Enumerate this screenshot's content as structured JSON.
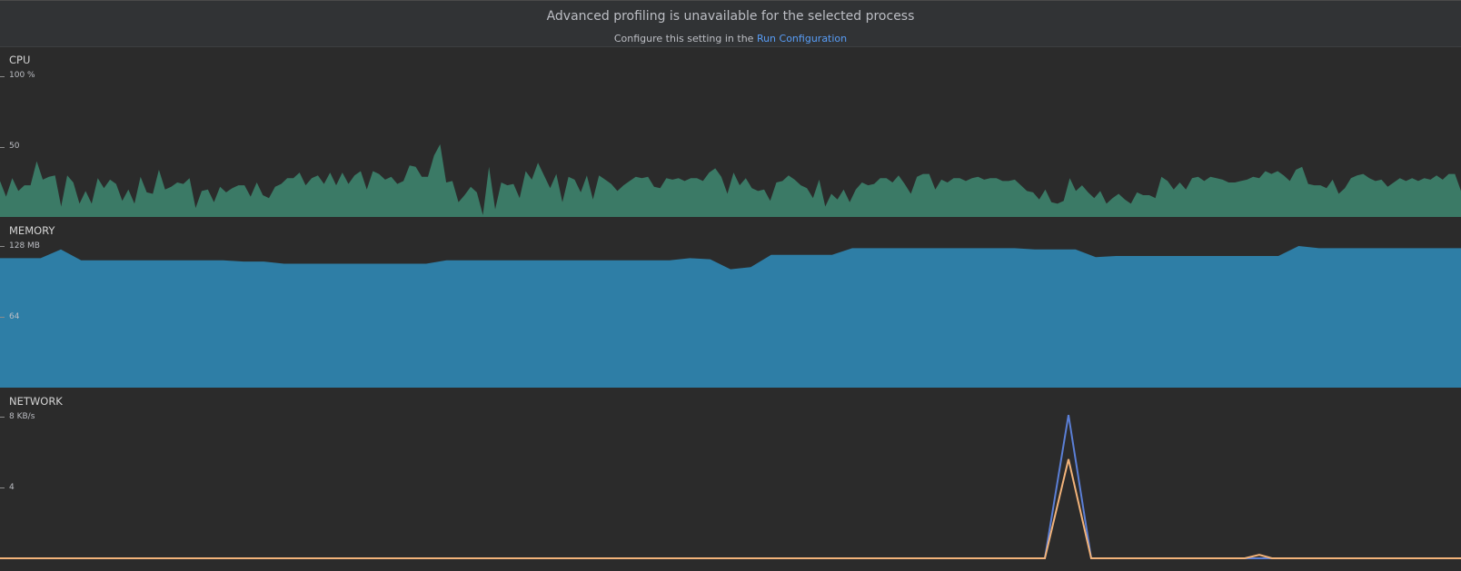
{
  "banner": {
    "title": "Advanced profiling is unavailable for the selected process",
    "subtitle_prefix": "Configure this setting in the",
    "link_label": "Run Configuration"
  },
  "cpu": {
    "title": "CPU",
    "ticks": [
      "100 %",
      "50"
    ],
    "color": "#3b7a66",
    "values": [
      26,
      15,
      28,
      19,
      23,
      23,
      40,
      27,
      29,
      30,
      8,
      30,
      25,
      10,
      19,
      10,
      28,
      21,
      27,
      24,
      12,
      20,
      10,
      29,
      18,
      17,
      34,
      20,
      22,
      25,
      24,
      28,
      7,
      19,
      20,
      11,
      22,
      18,
      21,
      23,
      23,
      15,
      25,
      16,
      14,
      22,
      24,
      28,
      28,
      32,
      23,
      28,
      30,
      24,
      32,
      23,
      32,
      24,
      30,
      33,
      20,
      33,
      31,
      27,
      29,
      24,
      26,
      37,
      36,
      29,
      29,
      44,
      52,
      25,
      26,
      11,
      16,
      22,
      18,
      2,
      36,
      6,
      25,
      23,
      24,
      14,
      33,
      27,
      39,
      30,
      21,
      31,
      11,
      29,
      27,
      18,
      30,
      13,
      30,
      27,
      24,
      19,
      23,
      26,
      29,
      28,
      29,
      22,
      21,
      28,
      27,
      28,
      26,
      28,
      28,
      26,
      32,
      35,
      29,
      17,
      32,
      23,
      28,
      21,
      19,
      20,
      12,
      25,
      26,
      30,
      27,
      23,
      21,
      14,
      27,
      8,
      17,
      13,
      20,
      11,
      20,
      25,
      23,
      24,
      28,
      28,
      25,
      30,
      24,
      17,
      29,
      31,
      31,
      20,
      27,
      25,
      28,
      28,
      26,
      28,
      29,
      27,
      28,
      28,
      26,
      26,
      27,
      23,
      19,
      18,
      13,
      20,
      11,
      10,
      12,
      28,
      19,
      23,
      18,
      14,
      19,
      10,
      14,
      17,
      13,
      10,
      18,
      16,
      16,
      14,
      29,
      26,
      20,
      25,
      20,
      28,
      29,
      26,
      29,
      28,
      27,
      25,
      25,
      26,
      27,
      29,
      28,
      33,
      31,
      33,
      30,
      26,
      34,
      36,
      24,
      23,
      23,
      21,
      27,
      17,
      21,
      28,
      30,
      31,
      28,
      26,
      27,
      22,
      25,
      28,
      26,
      28,
      26,
      28,
      27,
      30,
      27,
      31,
      31,
      19
    ]
  },
  "memory": {
    "title": "MEMORY",
    "ticks": [
      "128 MB",
      "64"
    ],
    "color": "#2e7ea6",
    "values": [
      117,
      117,
      117,
      125,
      115,
      115,
      115,
      115,
      115,
      115,
      115,
      115,
      114,
      114,
      112,
      112,
      112,
      112,
      112,
      112,
      112,
      112,
      115,
      115,
      115,
      115,
      115,
      115,
      115,
      115,
      115,
      115,
      115,
      115,
      117,
      116,
      107,
      109,
      120,
      120,
      120,
      120,
      126,
      126,
      126,
      126,
      126,
      126,
      126,
      126,
      126,
      125,
      125,
      125,
      118,
      119,
      119,
      119,
      119,
      119,
      119,
      119,
      119,
      119,
      128,
      126,
      126,
      126,
      126,
      126,
      126,
      126,
      126
    ]
  },
  "network": {
    "title": "NETWORK",
    "ticks": [
      "8 KB/s",
      "4"
    ],
    "sent_color": "#5b7fd6",
    "received_color": "#f2b37a",
    "sent": [
      [
        0,
        0
      ],
      [
        1150,
        0
      ],
      [
        1176,
        8.1
      ],
      [
        1201,
        0
      ],
      [
        1608,
        0
      ]
    ],
    "received": [
      [
        0,
        0
      ],
      [
        1150,
        0
      ],
      [
        1176,
        5.6
      ],
      [
        1201,
        0
      ],
      [
        1370,
        0
      ],
      [
        1386,
        0.2
      ],
      [
        1400,
        0
      ],
      [
        1608,
        0
      ]
    ]
  }
}
